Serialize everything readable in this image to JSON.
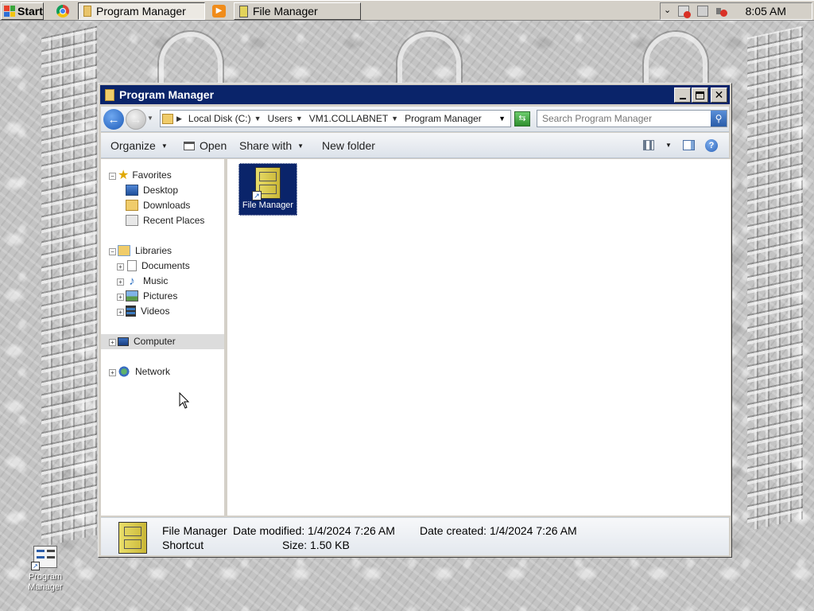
{
  "taskbar": {
    "start_label": "Start",
    "tasks": [
      {
        "label": "Program Manager",
        "active": true
      },
      {
        "label": "File Manager",
        "active": false
      }
    ],
    "clock": "8:05 AM"
  },
  "window": {
    "title": "Program Manager",
    "address": {
      "crumbs": [
        "Local Disk (C:)",
        "Users",
        "VM1.COLLABNET",
        "Program Manager"
      ]
    },
    "search": {
      "placeholder": "Search Program Manager"
    },
    "commands": {
      "organize": "Organize",
      "open": "Open",
      "share_with": "Share with",
      "new_folder": "New folder"
    },
    "nav": {
      "favorites": {
        "label": "Favorites",
        "items": [
          "Desktop",
          "Downloads",
          "Recent Places"
        ]
      },
      "libraries": {
        "label": "Libraries",
        "items": [
          "Documents",
          "Music",
          "Pictures",
          "Videos"
        ]
      },
      "computer": "Computer",
      "network": "Network"
    },
    "files": [
      {
        "name": "File Manager",
        "selected": true
      }
    ],
    "details": {
      "name": "File Manager",
      "type": "Shortcut",
      "date_modified": "Date modified: 1/4/2024 7:26 AM",
      "date_created": "Date created: 1/4/2024 7:26 AM",
      "size": "Size: 1.50 KB"
    }
  },
  "desktop": {
    "icons": [
      {
        "label": "Program Manager"
      }
    ]
  },
  "colors": {
    "titlebar": "#0a246a",
    "selection": "#0a246a",
    "window_chrome": "#d4d0c8"
  }
}
